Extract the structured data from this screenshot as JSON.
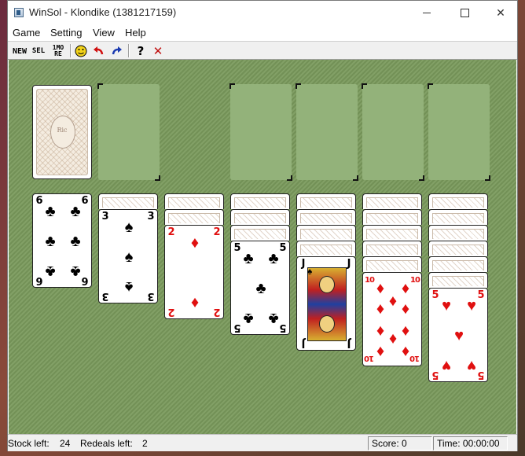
{
  "window": {
    "title": "WinSol - Klondike (1381217159)"
  },
  "menu": [
    "Game",
    "Setting",
    "View",
    "Help"
  ],
  "toolbar": {
    "new_label": "NEW",
    "select_label": "SEL",
    "one_more_label": "1MO RE",
    "buttons": [
      "new-game",
      "select-game",
      "one-more-redeal",
      "smiley",
      "undo",
      "redo",
      "help",
      "exit"
    ]
  },
  "tableau": [
    {
      "rank": "6",
      "suit": "♣",
      "color": "black",
      "hidden_count": 0
    },
    {
      "rank": "3",
      "suit": "♠",
      "color": "black",
      "hidden_count": 1
    },
    {
      "rank": "2",
      "suit": "♦",
      "color": "red",
      "hidden_count": 2
    },
    {
      "rank": "5",
      "suit": "♣",
      "color": "black",
      "hidden_count": 3
    },
    {
      "rank": "J",
      "suit": "♠",
      "color": "black",
      "hidden_count": 4
    },
    {
      "rank": "10",
      "suit": "♦",
      "color": "red",
      "hidden_count": 5
    },
    {
      "rank": "5",
      "suit": "♥",
      "color": "red",
      "hidden_count": 6
    }
  ],
  "card_back_logo": "Ric",
  "status": {
    "stock_left_label": "Stock left:",
    "stock_left_value": "24",
    "redeals_left_label": "Redeals left:",
    "redeals_left_value": "2",
    "score": "Score: 0",
    "time": "Time: 00:00:00"
  },
  "colors": {
    "felt": "#7a9a5c",
    "slot": "#93b27a",
    "red_suit": "#e01010"
  }
}
